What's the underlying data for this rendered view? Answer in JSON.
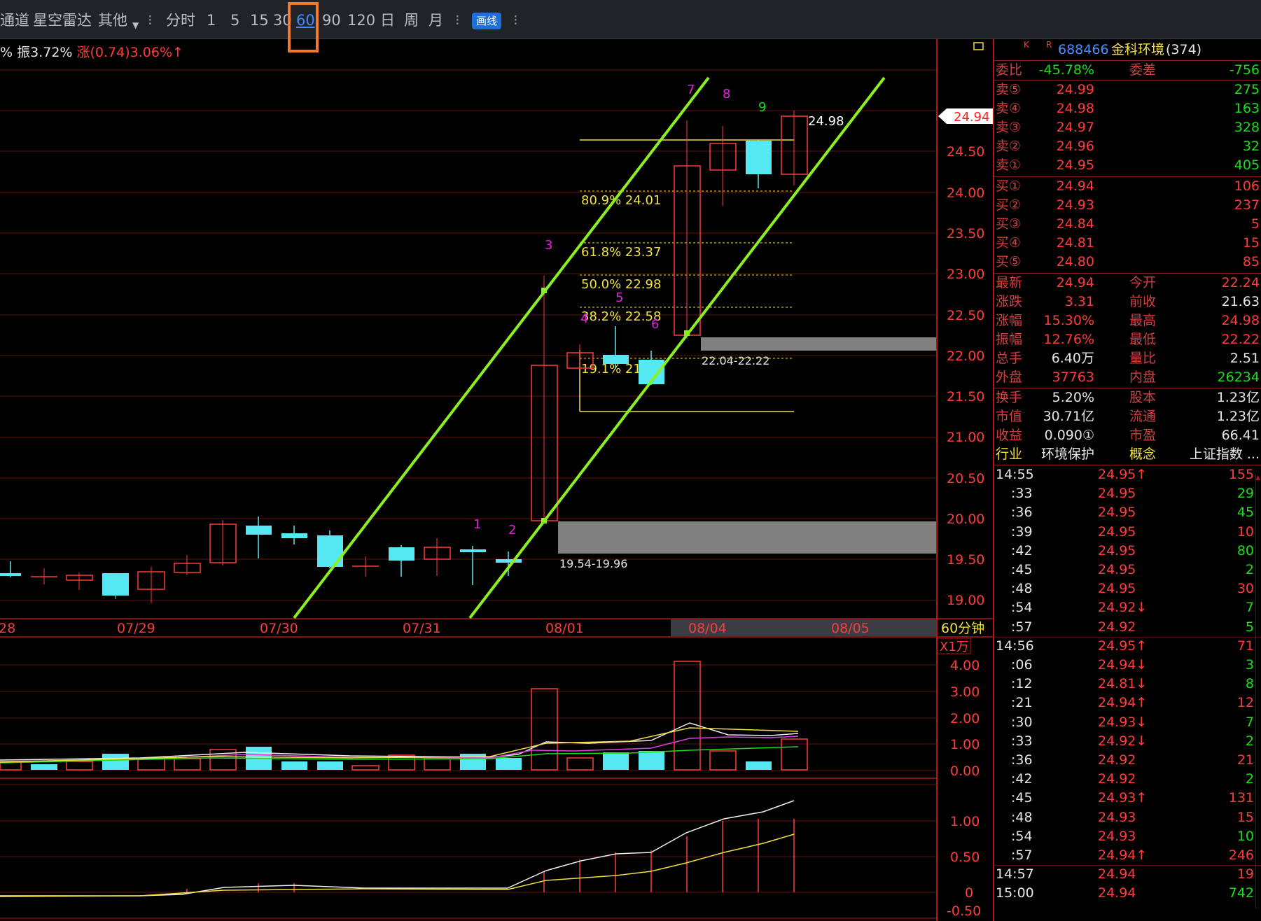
{
  "toolbar": {
    "items": [
      "通道",
      "星空雷达",
      "其他",
      "分时",
      "1",
      "5",
      "15",
      "30",
      "60",
      "90",
      "120",
      "日",
      "周",
      "月"
    ],
    "draw_btn": "画线",
    "sep": "⁝"
  },
  "status": {
    "amp": "振3.72%",
    "chg": "涨(0.74)3.06%↑",
    "pct_lead": "%"
  },
  "chart": {
    "yticks": [
      "24.50",
      "24.00",
      "23.50",
      "23.00",
      "22.50",
      "22.00",
      "21.50",
      "21.00",
      "20.50",
      "20.00",
      "19.50",
      "19.00"
    ],
    "xticks": [
      "28",
      "07/29",
      "07/30",
      "07/31",
      "08/01",
      "08/04",
      "08/05"
    ],
    "period": "60分钟",
    "last_price": "24.94",
    "high_label": "24.98",
    "fib": [
      "80.9% 24.01",
      "61.8% 23.37",
      "50.0% 22.98",
      "38.2% 22.58",
      "19.1% 21.95"
    ],
    "zone1": "22.04-22.22",
    "zone2": "19.54-19.96",
    "nums": [
      "1",
      "2",
      "3",
      "4",
      "5",
      "6",
      "7",
      "8",
      "9"
    ]
  },
  "vol": {
    "unit": "X1万",
    "yticks": [
      "4.00",
      "3.00",
      "2.00",
      "1.00",
      "0.00"
    ]
  },
  "ind": {
    "yticks": [
      "1.00",
      "0.50",
      "0",
      "-0.50"
    ]
  },
  "panel": {
    "kr": [
      "K",
      "R"
    ],
    "code": "688466",
    "name": "金科环境",
    "count": "(374)",
    "wb": {
      "l1": "委比",
      "v1": "-45.78%",
      "l2": "委差",
      "v2": "-756"
    },
    "asks": [
      [
        "卖⑤",
        "24.99",
        "275"
      ],
      [
        "卖④",
        "24.98",
        "163"
      ],
      [
        "卖③",
        "24.97",
        "328"
      ],
      [
        "卖②",
        "24.96",
        "32"
      ],
      [
        "卖①",
        "24.95",
        "405"
      ]
    ],
    "bids": [
      [
        "买①",
        "24.94",
        "106"
      ],
      [
        "买②",
        "24.93",
        "237"
      ],
      [
        "买③",
        "24.84",
        "5"
      ],
      [
        "买④",
        "24.81",
        "15"
      ],
      [
        "买⑤",
        "24.80",
        "85"
      ]
    ],
    "stats": [
      [
        "最新",
        "24.94",
        "今开",
        "22.24"
      ],
      [
        "涨跌",
        "3.31",
        "前收",
        "21.63"
      ],
      [
        "涨幅",
        "15.30%",
        "最高",
        "24.98"
      ],
      [
        "振幅",
        "12.76%",
        "最低",
        "22.22"
      ],
      [
        "总手",
        "6.40万",
        "量比",
        "2.51"
      ],
      [
        "外盘",
        "37763",
        "内盘",
        "26234"
      ]
    ],
    "stats2": [
      [
        "换手",
        "5.20%",
        "股本",
        "1.23亿"
      ],
      [
        "市值",
        "30.71亿",
        "流通",
        "1.23亿"
      ],
      [
        "收益",
        "0.090①",
        "市盈",
        "66.41"
      ],
      [
        "行业",
        "环境保护",
        "概念",
        "上证指数 ..."
      ]
    ],
    "ticks": [
      [
        "14:55",
        "24.95↑",
        "155"
      ],
      [
        ":33",
        "24.95",
        "29"
      ],
      [
        ":36",
        "24.95",
        "45"
      ],
      [
        ":39",
        "24.95",
        "10"
      ],
      [
        ":42",
        "24.95",
        "80"
      ],
      [
        ":45",
        "24.95",
        "2"
      ],
      [
        ":48",
        "24.95",
        "30"
      ],
      [
        ":54",
        "24.92↓",
        "7"
      ],
      [
        ":57",
        "24.92",
        "5"
      ],
      [
        "14:56",
        "24.95↑",
        "71"
      ],
      [
        ":06",
        "24.94↓",
        "3"
      ],
      [
        ":12",
        "24.81↓",
        "8"
      ],
      [
        ":21",
        "24.94↑",
        "12"
      ],
      [
        ":30",
        "24.93↓",
        "7"
      ],
      [
        ":33",
        "24.92↓",
        "2"
      ],
      [
        ":36",
        "24.92",
        "21"
      ],
      [
        ":42",
        "24.92",
        "2"
      ],
      [
        ":45",
        "24.93↑",
        "131"
      ],
      [
        ":48",
        "24.93",
        "15"
      ],
      [
        ":54",
        "24.93",
        "10"
      ],
      [
        ":57",
        "24.94↑",
        "246"
      ],
      [
        "14:57",
        "24.94",
        "19"
      ],
      [
        "15:00",
        "24.94",
        "742"
      ]
    ]
  }
}
